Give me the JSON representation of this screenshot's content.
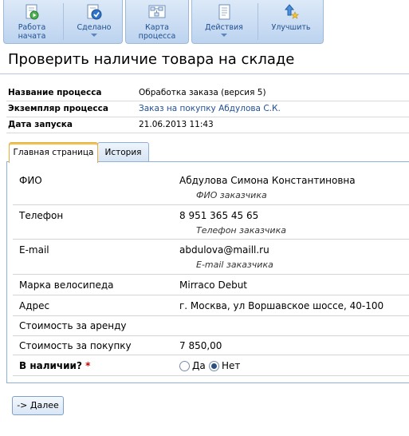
{
  "toolbar": {
    "buttons": [
      {
        "label_line1": "Работа",
        "label_line2": "начата",
        "icon": "play-document-icon"
      },
      {
        "label_line1": "Сделано",
        "icon": "document-checkmark-icon"
      },
      {
        "label_line1": "Карта",
        "label_line2": "процесса",
        "icon": "process-map-icon"
      },
      {
        "label_line1": "Действия",
        "icon": "actions-document-icon"
      },
      {
        "label_line1": "Улучшить",
        "icon": "improve-star-icon"
      }
    ]
  },
  "page": {
    "title": "Проверить наличие товара на складе"
  },
  "info": {
    "process_name_label": "Название процесса",
    "process_name_value": "Обработка заказа (версия 5)",
    "instance_label": "Экземпляр процесса",
    "instance_value": "Заказ на покупку Абдулова С.К.",
    "start_date_label": "Дата запуска",
    "start_date_value": "21.06.2013 11:43"
  },
  "tabs": [
    {
      "label": "Главная страница",
      "active": true
    },
    {
      "label": "История",
      "active": false
    }
  ],
  "form": {
    "fio_label": "ФИО",
    "fio_value": "Абдулова Симона Константиновна",
    "fio_hint": "ФИО заказчика",
    "phone_label": "Телефон",
    "phone_value": "8 951 365 45 65",
    "phone_hint": "Телефон заказчика",
    "email_label": "E-mail",
    "email_value": "abdulova@maill.ru",
    "email_hint": "E-mail заказчика",
    "bike_label": "Марка велосипеда",
    "bike_value": "Mirraco Debut",
    "address_label": "Адрес",
    "address_value": "г. Москва, ул Воршавское шоссе, 40-100",
    "rent_label": "Стоимость за аренду",
    "rent_value": "",
    "buy_label": "Стоимость за покупку",
    "buy_value": "7 850,00",
    "stock_label": "В наличии?",
    "stock_required": "*",
    "stock_options": [
      "Да",
      "Нет"
    ],
    "stock_selected": "Нет"
  },
  "actions": {
    "next_label": "-> Далее"
  }
}
